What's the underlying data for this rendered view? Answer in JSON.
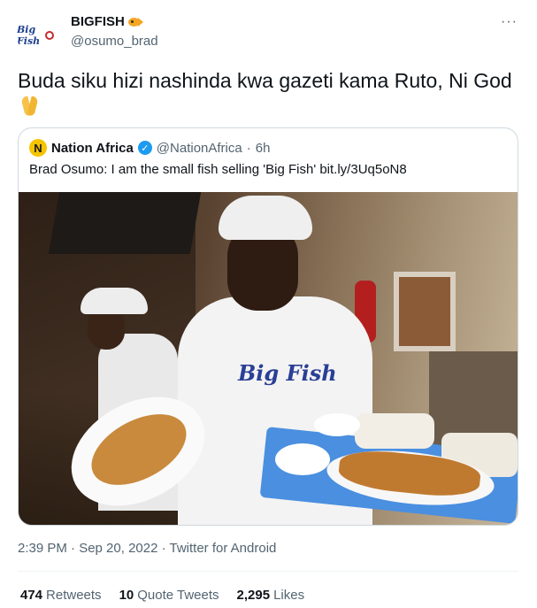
{
  "author": {
    "display_name": "BIGFISH",
    "handle": "@osumo_brad",
    "avatar_text": "Big Fish"
  },
  "tweet": {
    "text": "Buda siku hizi nashinda kwa gazeti kama Ruto, Ni God"
  },
  "quoted_tweet": {
    "avatar_letter": "N",
    "display_name": "Nation Africa",
    "handle": "@NationAfrica",
    "separator": "·",
    "time": "6h",
    "text": "Brad Osumo: I am the small fish selling 'Big Fish' bit.ly/3Uq5oN8",
    "media": {
      "shirt_logo": "Big Fish"
    }
  },
  "meta": {
    "timestamp": "2:39 PM · Sep 20, 2022 · Twitter for Android"
  },
  "stats": {
    "retweets_count": "474",
    "retweets_label": "Retweets",
    "quote_count": "10",
    "quote_label": "Quote Tweets",
    "likes_count": "2,295",
    "likes_label": "Likes"
  },
  "menu": {
    "more_label": "···"
  },
  "colors": {
    "verified": "#1d9bf0",
    "secondary_text": "#536471",
    "border": "#cfd9de"
  }
}
